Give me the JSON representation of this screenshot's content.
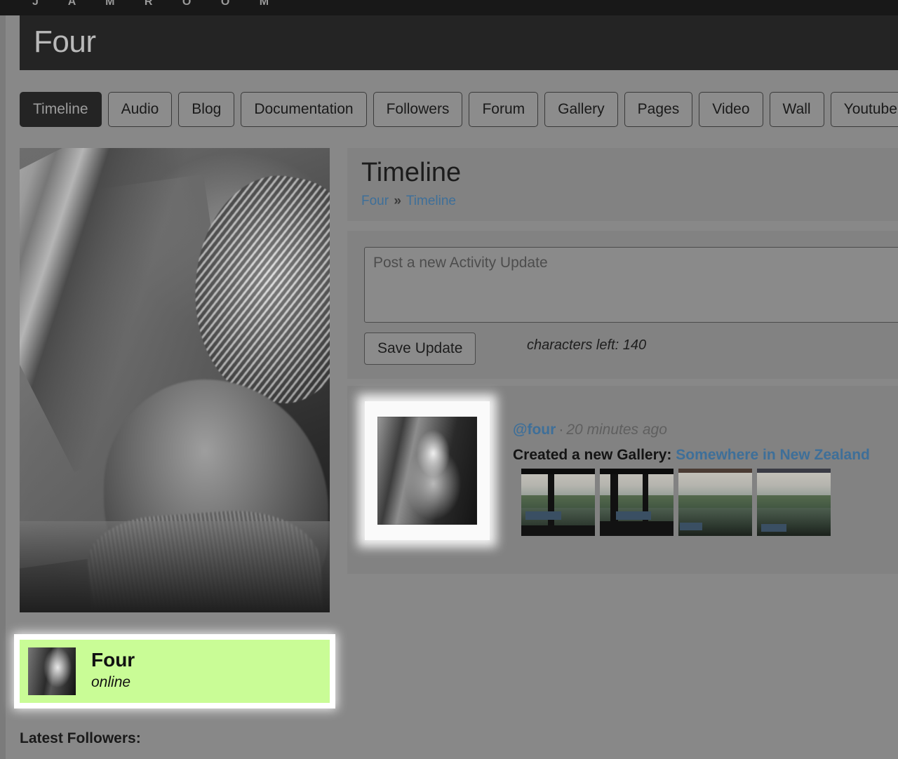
{
  "brand": {
    "wordmark": "J A M R O O M"
  },
  "header": {
    "profile_title": "Four"
  },
  "tabs": [
    {
      "label": "Timeline",
      "active": true
    },
    {
      "label": "Audio",
      "active": false
    },
    {
      "label": "Blog",
      "active": false
    },
    {
      "label": "Documentation",
      "active": false
    },
    {
      "label": "Followers",
      "active": false
    },
    {
      "label": "Forum",
      "active": false
    },
    {
      "label": "Gallery",
      "active": false
    },
    {
      "label": "Pages",
      "active": false
    },
    {
      "label": "Video",
      "active": false
    },
    {
      "label": "Wall",
      "active": false
    },
    {
      "label": "Youtube",
      "active": false
    }
  ],
  "page": {
    "heading": "Timeline",
    "breadcrumb": {
      "root": "Four",
      "separator": "»",
      "current": "Timeline"
    }
  },
  "composer": {
    "placeholder": "Post a new Activity Update",
    "value": "",
    "save_label": "Save Update",
    "characters_left": "characters left: 140"
  },
  "activity": [
    {
      "handle": "@four",
      "separator": "·",
      "time": "20 minutes ago",
      "text_prefix": "Created a new Gallery:",
      "link_label": "Somewhere in New Zealand",
      "thumbnail_count": 4
    }
  ],
  "sidebar": {
    "online_card": {
      "name": "Four",
      "status": "online"
    },
    "latest_followers_label": "Latest Followers:"
  },
  "colors": {
    "page_background": "#888888",
    "panel_background": "#828282",
    "header_band": "#242424",
    "top_strip": "#181818",
    "link": "#3e6f99",
    "online_highlight": "#c9fc96",
    "active_tab_text": "#9d9d9d"
  }
}
